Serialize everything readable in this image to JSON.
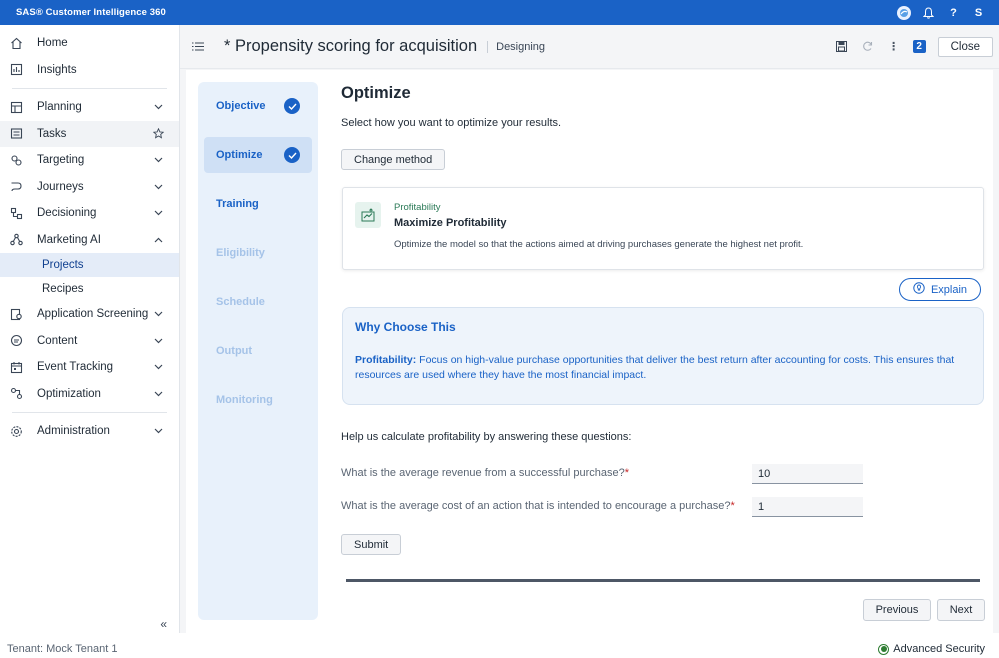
{
  "app": {
    "brand": "SAS® Customer Intelligence 360",
    "user_initial": "S"
  },
  "sidebar": {
    "items": [
      {
        "label": "Home",
        "icon": "home-icon"
      },
      {
        "label": "Insights",
        "icon": "insights-icon"
      },
      {
        "label": "Planning",
        "icon": "planning-icon"
      },
      {
        "label": "Tasks",
        "icon": "tasks-icon"
      },
      {
        "label": "Targeting",
        "icon": "targeting-icon"
      },
      {
        "label": "Journeys",
        "icon": "journeys-icon"
      },
      {
        "label": "Decisioning",
        "icon": "decisioning-icon"
      },
      {
        "label": "Marketing AI",
        "icon": "marketing-ai-icon"
      },
      {
        "label": "Application Screening",
        "icon": "app-screening-icon"
      },
      {
        "label": "Content",
        "icon": "content-icon"
      },
      {
        "label": "Event Tracking",
        "icon": "event-tracking-icon"
      },
      {
        "label": "Optimization",
        "icon": "optimization-icon"
      },
      {
        "label": "Administration",
        "icon": "administration-icon"
      }
    ],
    "subitems": [
      {
        "label": "Projects"
      },
      {
        "label": "Recipes"
      }
    ],
    "collapse_label": "«"
  },
  "header": {
    "title": "* Propensity scoring for acquisition",
    "status": "Designing",
    "badge_count": "2",
    "close_label": "Close"
  },
  "steps": [
    {
      "label": "Objective",
      "state": "done"
    },
    {
      "label": "Optimize",
      "state": "current"
    },
    {
      "label": "Training",
      "state": "active"
    },
    {
      "label": "Eligibility",
      "state": "disabled"
    },
    {
      "label": "Schedule",
      "state": "disabled"
    },
    {
      "label": "Output",
      "state": "disabled"
    },
    {
      "label": "Monitoring",
      "state": "disabled"
    }
  ],
  "main": {
    "title": "Optimize",
    "subtitle": "Select how you want to optimize your results.",
    "change_method_label": "Change method",
    "method": {
      "category": "Profitability",
      "name": "Maximize Profitability",
      "description": "Optimize the model so that the actions aimed at driving purchases generate the highest net profit."
    },
    "explain_label": "Explain",
    "why": {
      "title": "Why Choose This",
      "bold": "Profitability:",
      "text": " Focus on high-value purchase opportunities that deliver the best return after accounting for costs. This ensures that resources are used where they have the most financial impact."
    },
    "help_text": "Help us calculate profitability by answering these questions:",
    "questions": [
      {
        "label": "What is the average revenue from a successful purchase?",
        "required": "*",
        "value": "10"
      },
      {
        "label": "What is the average cost of an action that is intended to encourage a purchase?",
        "required": "*",
        "value": "1"
      }
    ],
    "submit_label": "Submit",
    "previous_label": "Previous",
    "next_label": "Next"
  },
  "footer": {
    "tenant": "Tenant: Mock Tenant 1",
    "security": "Advanced Security"
  },
  "colors": {
    "brand_blue": "#1a62c6",
    "stepper_bg": "#e8f1fb",
    "profit_green": "#2b7a57"
  }
}
